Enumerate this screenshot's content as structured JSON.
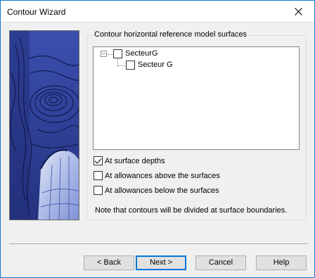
{
  "window": {
    "title": "Contour Wizard"
  },
  "groupbox": {
    "label": "Contour horizontal reference model surfaces"
  },
  "tree": {
    "root": {
      "label": "SecteurG",
      "checked": false,
      "expanded": true
    },
    "child": {
      "label": "Secteur G",
      "checked": false
    }
  },
  "options": [
    {
      "label": "At surface depths",
      "checked": true
    },
    {
      "label": "At allowances above the surfaces",
      "checked": false
    },
    {
      "label": "At allowances below the surfaces",
      "checked": false
    }
  ],
  "note": "Note that contours will be divided at surface boundaries.",
  "buttons": {
    "back": "< Back",
    "next": "Next >",
    "cancel": "Cancel",
    "help": "Help"
  },
  "colors": {
    "accent": "#0078d7",
    "image_blue": "#2e3f9e"
  }
}
